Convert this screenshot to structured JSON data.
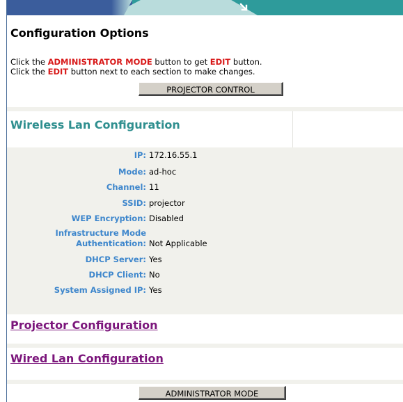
{
  "page_title": "Configuration Options",
  "instructions": {
    "line1_pre": "Click the ",
    "line1_hl1": "ADMINISTRATOR MODE",
    "line1_mid": " button to get ",
    "line1_hl2": "EDIT",
    "line1_post": " button.",
    "line2_pre": "Click the ",
    "line2_hl": "EDIT",
    "line2_post": " button next to each section to make changes."
  },
  "buttons": {
    "projector_control": "PROJECTOR CONTROL",
    "administrator_mode": "ADMINISTRATOR MODE"
  },
  "sections": {
    "wireless": "Wireless Lan Configuration",
    "projector": "Projector Configuration",
    "wired": "Wired Lan Configuration"
  },
  "wireless_details": {
    "ip_label": "IP:",
    "ip_value": "172.16.55.1",
    "mode_label": "Mode:",
    "mode_value": "ad-hoc",
    "channel_label": "Channel:",
    "channel_value": "11",
    "ssid_label": "SSID:",
    "ssid_value": "projector",
    "wep_label": "WEP Encryption:",
    "wep_value": "Disabled",
    "infra_label_line1": "Infrastructure Mode",
    "infra_label_line2": "Authentication:",
    "infra_value": "Not Applicable",
    "dhcp_server_label": "DHCP Server:",
    "dhcp_server_value": "Yes",
    "dhcp_client_label": "DHCP Client:",
    "dhcp_client_value": "No",
    "sys_ip_label": "System Assigned IP:",
    "sys_ip_value": "Yes"
  },
  "colors": {
    "banner_blue": "#3b5d9c",
    "banner_teal": "#2e9b9b",
    "highlight_red": "#d81919",
    "label_blue": "#3d86cc",
    "section_teal": "#2f8f8f",
    "link_purple": "#7b157b"
  },
  "icons": {
    "banner_arrow": "arrow-down-right-icon"
  }
}
